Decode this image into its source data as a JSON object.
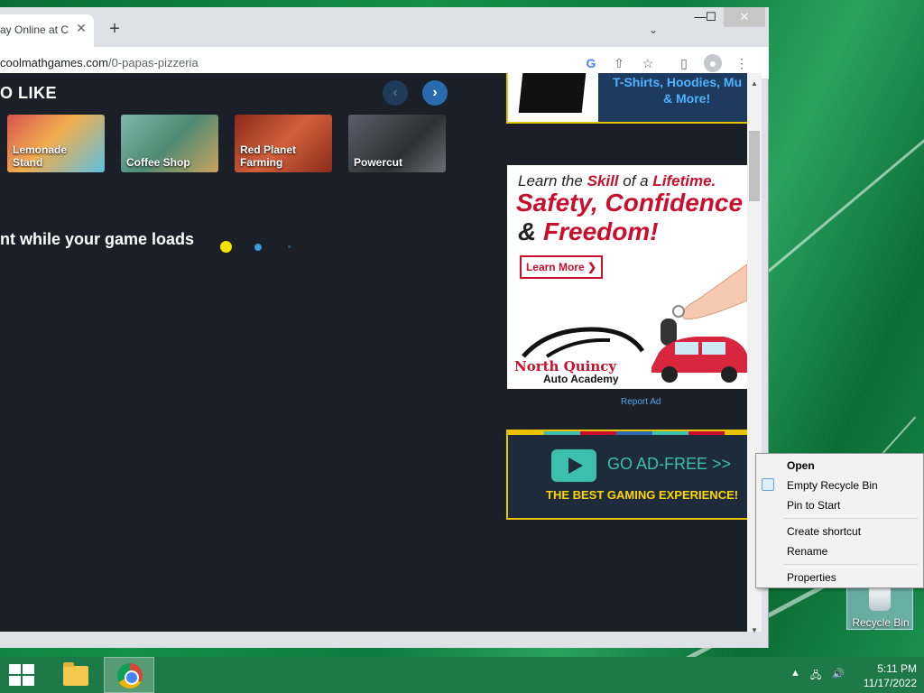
{
  "browser": {
    "tab_title": "ay Online at C",
    "tab_close": "✕",
    "new_tab": "+",
    "tab_search": "⌄",
    "url_domain": "coolmathgames.com",
    "url_path": "/0-papas-pizzeria",
    "window_minimize": "—",
    "window_maximize": "☐",
    "window_close": "✕"
  },
  "page": {
    "section_heading": "O LIKE",
    "games": [
      {
        "name": "Lemonade\nStand",
        "color": "#c4473a"
      },
      {
        "name": "Coffee Shop",
        "color": "#4e8a74"
      },
      {
        "name": "Red Planet\nFarming",
        "color": "#b8402e"
      },
      {
        "name": "Powercut",
        "color": "#3a4048"
      }
    ],
    "loading_text": "nt while your game loads",
    "dot_colors": [
      "#f5e100",
      "#3a9ad9",
      "#2a5a7a"
    ]
  },
  "ads": {
    "top_line1": "T-Shirts, Hoodies, Mu",
    "top_line2": "& More!",
    "main_line1_pre": "Learn the ",
    "main_line1_skill": "Skill",
    "main_line1_mid": " of a ",
    "main_line1_lifetime": "Lifetime.",
    "main_line2": "Safety, Confidence",
    "main_line3_amp": "& ",
    "main_line3_word": "Freedom!",
    "learn_more": "Learn More ❯",
    "brand_line1": "North Quincy",
    "brand_line2": "Auto Academy",
    "report_ad": "Report Ad",
    "adfree_title": "GO AD-FREE >>",
    "adfree_sub": "THE BEST GAMING EXPERIENCE!"
  },
  "context_menu": {
    "items": [
      "Open",
      "Empty Recycle Bin",
      "Pin to Start",
      "Create shortcut",
      "Rename",
      "Properties"
    ]
  },
  "desktop": {
    "recycle_bin_label": "Recycle Bin"
  },
  "taskbar": {
    "time": "5:11 PM",
    "date": "11/17/2022"
  }
}
